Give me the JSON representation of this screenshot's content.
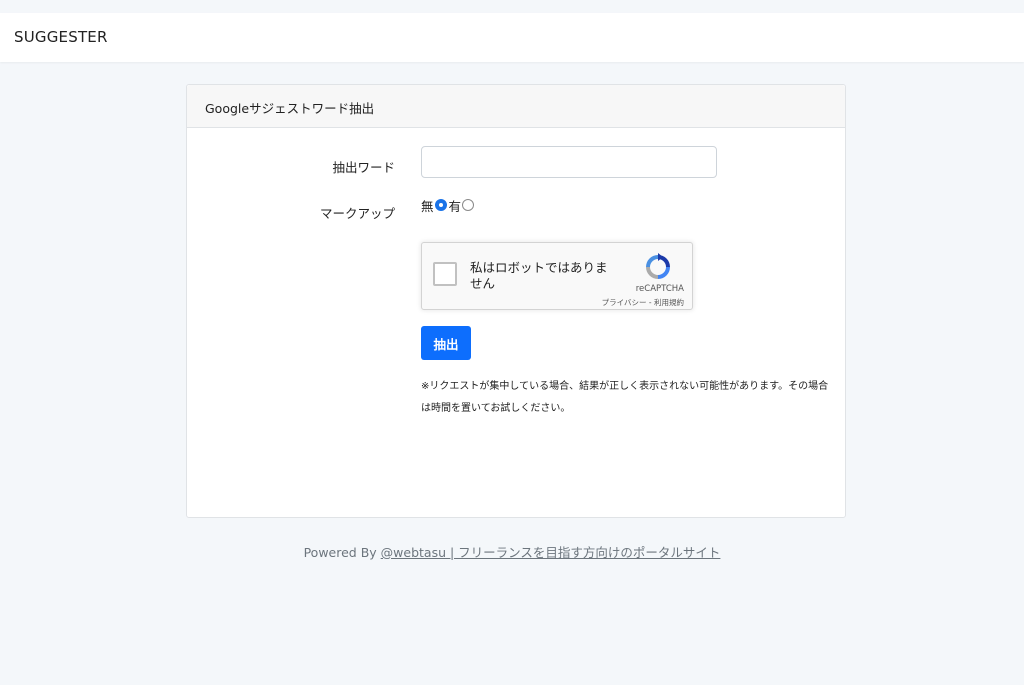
{
  "navbar": {
    "brand": "SUGGESTER"
  },
  "card": {
    "title": "Googleサジェストワード抽出",
    "word_label": "抽出ワード",
    "word_value": "",
    "markup_label": "マークアップ",
    "markup_options": [
      {
        "label": "無",
        "selected": true
      },
      {
        "label": "有",
        "selected": false
      }
    ],
    "recaptcha": {
      "text": "私はロボットではありません",
      "brand": "reCAPTCHA",
      "links": "プライバシー - 利用規約"
    },
    "submit_label": "抽出",
    "note": "※リクエストが集中している場合、結果が正しく表示されない可能性があります。その場合は時間を置いてお試しください。"
  },
  "footer": {
    "prefix": "Powered By",
    "link_text": "@webtasu | フリーランスを目指す方向けのポータルサイト"
  },
  "colors": {
    "primary": "#0d6efd",
    "background": "#f4f7fa",
    "radio_checked": "#1a73e8"
  },
  "icons": {
    "recaptcha_logo": "recaptcha-logo-icon"
  }
}
